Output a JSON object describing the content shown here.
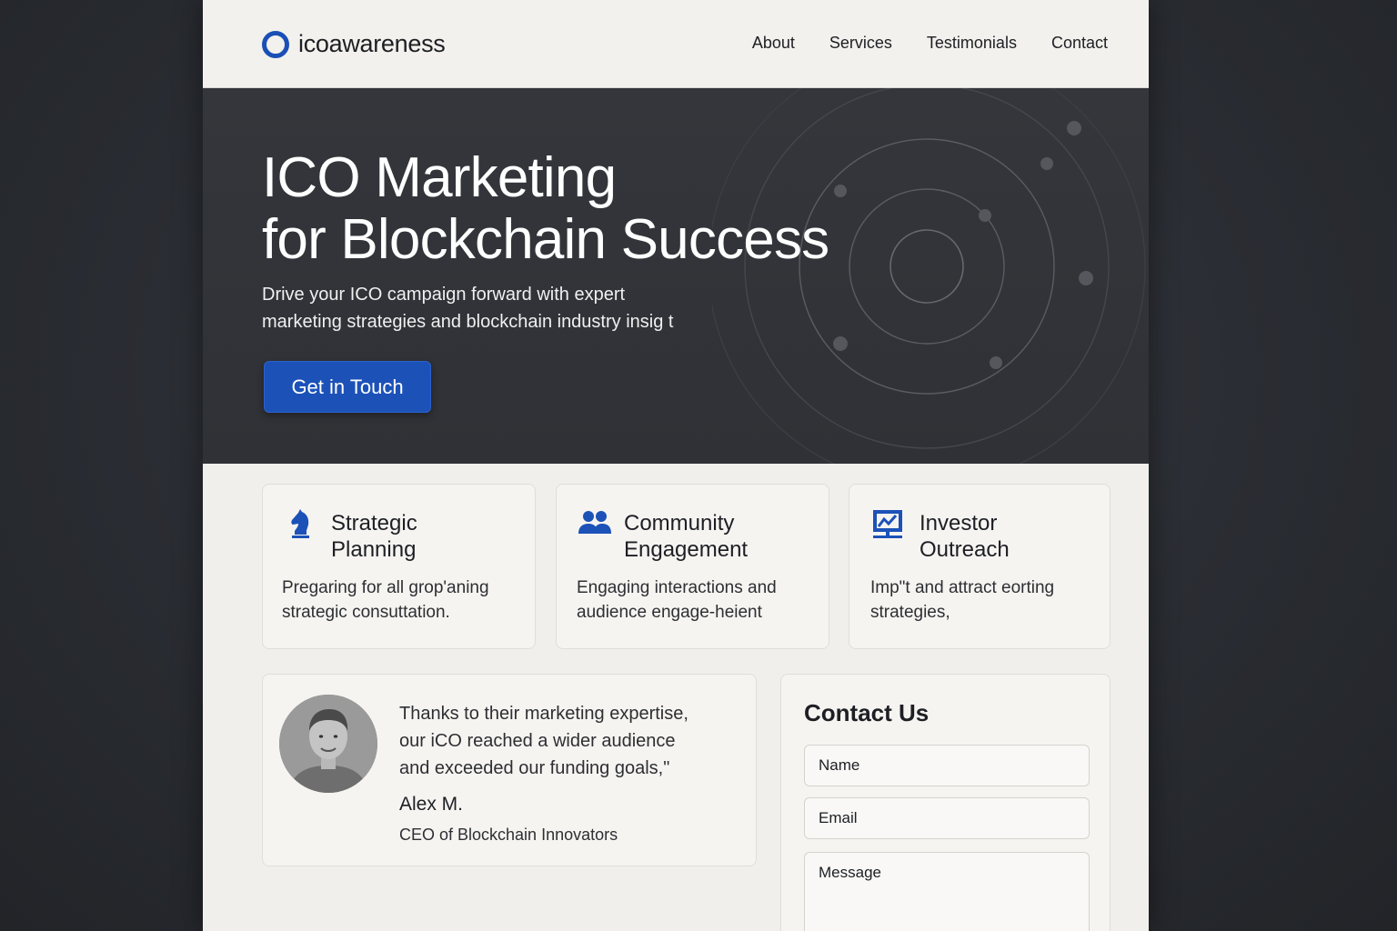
{
  "brand": {
    "name": "icoawareness",
    "accent": "#1c52b8"
  },
  "nav": [
    {
      "label": "About"
    },
    {
      "label": "Services"
    },
    {
      "label": "Testimonials"
    },
    {
      "label": "Contact"
    }
  ],
  "hero": {
    "title_line1": "ICO Marketing",
    "title_line2": "for Blockchain Success",
    "subtitle_line1": "Drive your ICO campaign forward with expert",
    "subtitle_line2": "marketing strategies and blockchain industry insig t",
    "cta_label": "Get in Touch"
  },
  "features": [
    {
      "icon": "chess-knight-icon",
      "title_line1": "Strategic",
      "title_line2": "Planning",
      "text_line1": "Pregaring for all grop'aning",
      "text_line2": "strategic consuttation."
    },
    {
      "icon": "users-group-icon",
      "title_line1": "Community",
      "title_line2": "Engagement",
      "text_line1": "Engaging interactions and",
      "text_line2": "audience engage-heient"
    },
    {
      "icon": "presentation-chart-icon",
      "title_line1": "Investor",
      "title_line2": "Outreach",
      "text_line1": "Imp\"t and attract eorting",
      "text_line2": "strategies,"
    }
  ],
  "testimonial": {
    "quote_line1": "Thanks to their marketing expertise,",
    "quote_line2": "our iCO reached a wider audience",
    "quote_line3": "and exceeded our funding goals,\"",
    "author": "Alex M.",
    "role": "CEO of Blockchain Innovators"
  },
  "contact": {
    "title": "Contact Us",
    "name_placeholder": "Name",
    "email_placeholder": "Email",
    "message_placeholder": "Message"
  }
}
